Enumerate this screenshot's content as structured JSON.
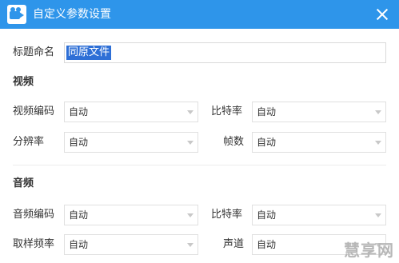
{
  "window": {
    "title": "自定义参数设置"
  },
  "title_field": {
    "label": "标题命名",
    "value": "同原文件"
  },
  "video": {
    "section_title": "视频",
    "codec_label": "视频编码",
    "codec_value": "自动",
    "bitrate_label": "比特率",
    "bitrate_value": "自动",
    "resolution_label": "分辨率",
    "resolution_value": "自动",
    "framerate_label": "帧数",
    "framerate_value": "自动"
  },
  "audio": {
    "section_title": "音频",
    "codec_label": "音频编码",
    "codec_value": "自动",
    "bitrate_label": "比特率",
    "bitrate_value": "自动",
    "samplerate_label": "取样频率",
    "samplerate_value": "自动",
    "channel_label": "声道",
    "channel_value": "自动"
  },
  "watermark": {
    "text": "慧享网"
  },
  "colors": {
    "titlebar": "#2e95ea",
    "selection": "#2e6fd6"
  }
}
